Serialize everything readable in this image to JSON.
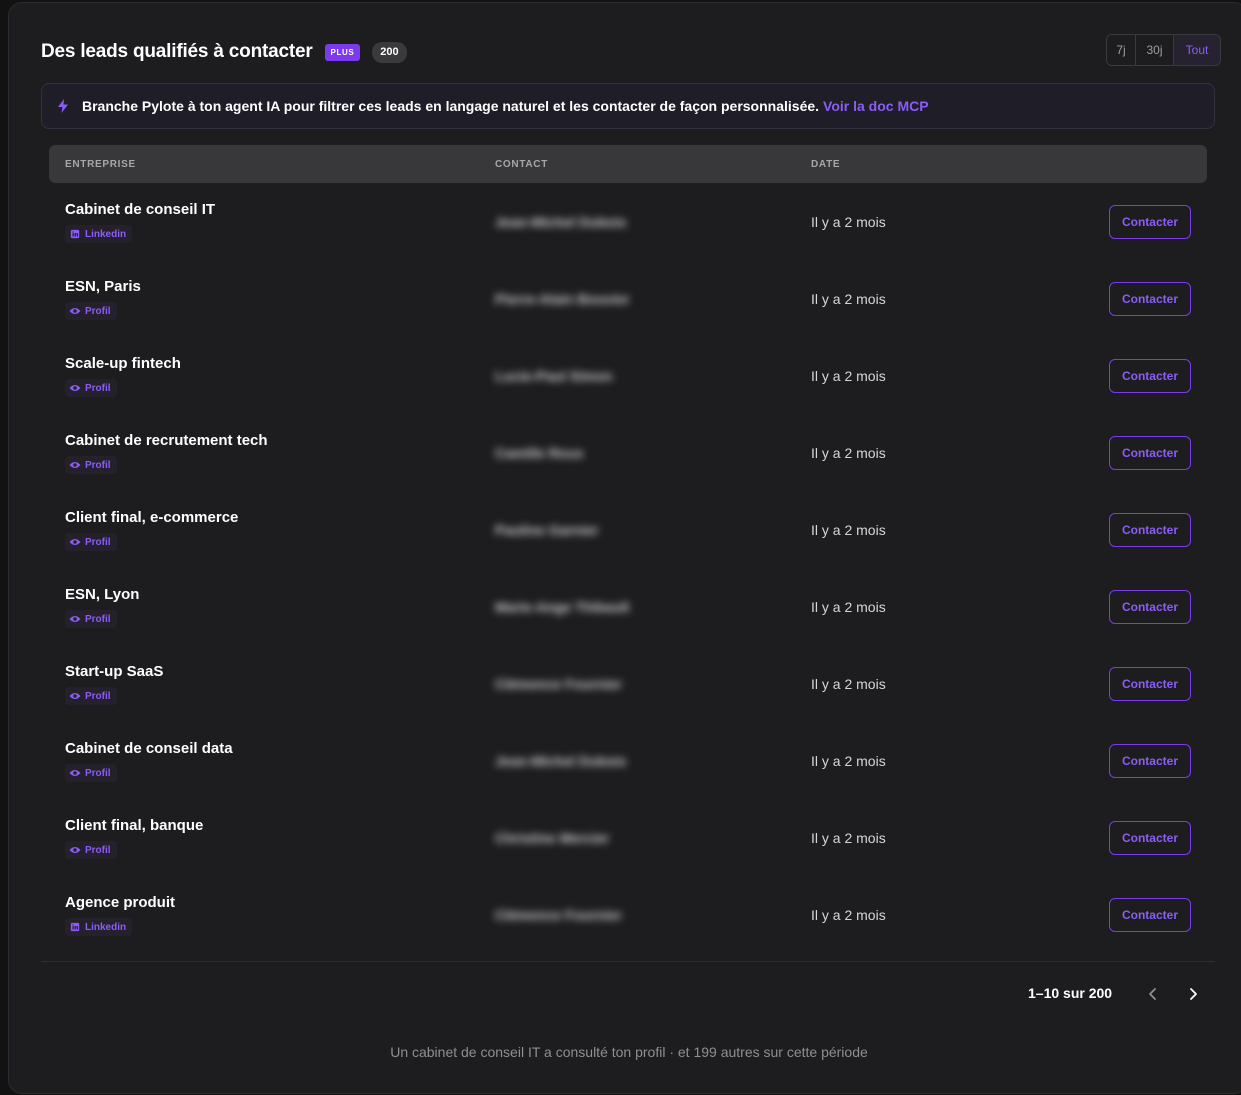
{
  "header": {
    "title": "Des leads qualifiés à contacter",
    "plan_badge": "PLUS",
    "count_badge": "200"
  },
  "range_filter": {
    "options": [
      "7j",
      "30j",
      "Tout"
    ],
    "selected": "Tout"
  },
  "banner": {
    "icon": "bolt-icon",
    "text": "Branche Pylote à ton agent IA pour filtrer ces leads en langage naturel et les contacter de façon personnalisée.",
    "link": "Voir la doc MCP"
  },
  "table": {
    "columns": [
      "ENTREPRISE",
      "CONTACT",
      "DATE"
    ],
    "rows": [
      {
        "company": "Cabinet de conseil IT",
        "source": "Linkedin",
        "source_icon": "linkedin-icon",
        "contact": "Jean-Michel Dubois",
        "date": "Il y a 2 mois",
        "action": "Contacter"
      },
      {
        "company": "ESN, Paris",
        "source": "Profil",
        "source_icon": "eye-icon",
        "contact": "Pierre-Alain Bouvier",
        "date": "Il y a 2 mois",
        "action": "Contacter"
      },
      {
        "company": "Scale-up fintech",
        "source": "Profil",
        "source_icon": "eye-icon",
        "contact": "Lucie-Paul Simon",
        "date": "Il y a 2 mois",
        "action": "Contacter"
      },
      {
        "company": "Cabinet de recrutement tech",
        "source": "Profil",
        "source_icon": "eye-icon",
        "contact": "Camille Roux",
        "date": "Il y a 2 mois",
        "action": "Contacter"
      },
      {
        "company": "Client final, e-commerce",
        "source": "Profil",
        "source_icon": "eye-icon",
        "contact": "Pauline Garnier",
        "date": "Il y a 2 mois",
        "action": "Contacter"
      },
      {
        "company": "ESN, Lyon",
        "source": "Profil",
        "source_icon": "eye-icon",
        "contact": "Marie-Ange Thibault",
        "date": "Il y a 2 mois",
        "action": "Contacter"
      },
      {
        "company": "Start-up SaaS",
        "source": "Profil",
        "source_icon": "eye-icon",
        "contact": "Clémence Fournier",
        "date": "Il y a 2 mois",
        "action": "Contacter"
      },
      {
        "company": "Cabinet de conseil data",
        "source": "Profil",
        "source_icon": "eye-icon",
        "contact": "Jean-Michel Dubois",
        "date": "Il y a 2 mois",
        "action": "Contacter"
      },
      {
        "company": "Client final, banque",
        "source": "Profil",
        "source_icon": "eye-icon",
        "contact": "Christine Mercier",
        "date": "Il y a 2 mois",
        "action": "Contacter"
      },
      {
        "company": "Agence produit",
        "source": "Linkedin",
        "source_icon": "linkedin-icon",
        "contact": "Clémence Fournier",
        "date": "Il y a 2 mois",
        "action": "Contacter"
      }
    ]
  },
  "pagination": {
    "label": "1–10 sur 200",
    "prev_icon": "chevron-left-icon",
    "next_icon": "chevron-right-icon"
  },
  "footer": {
    "text": "Un cabinet de conseil IT a consulté ton profil · et 199 autres sur cette période"
  },
  "colors": {
    "accent": "#8b5cf6",
    "accent_strong": "#7c3aed",
    "card_bg": "#1d1d1f",
    "header_bg": "#38383b"
  }
}
